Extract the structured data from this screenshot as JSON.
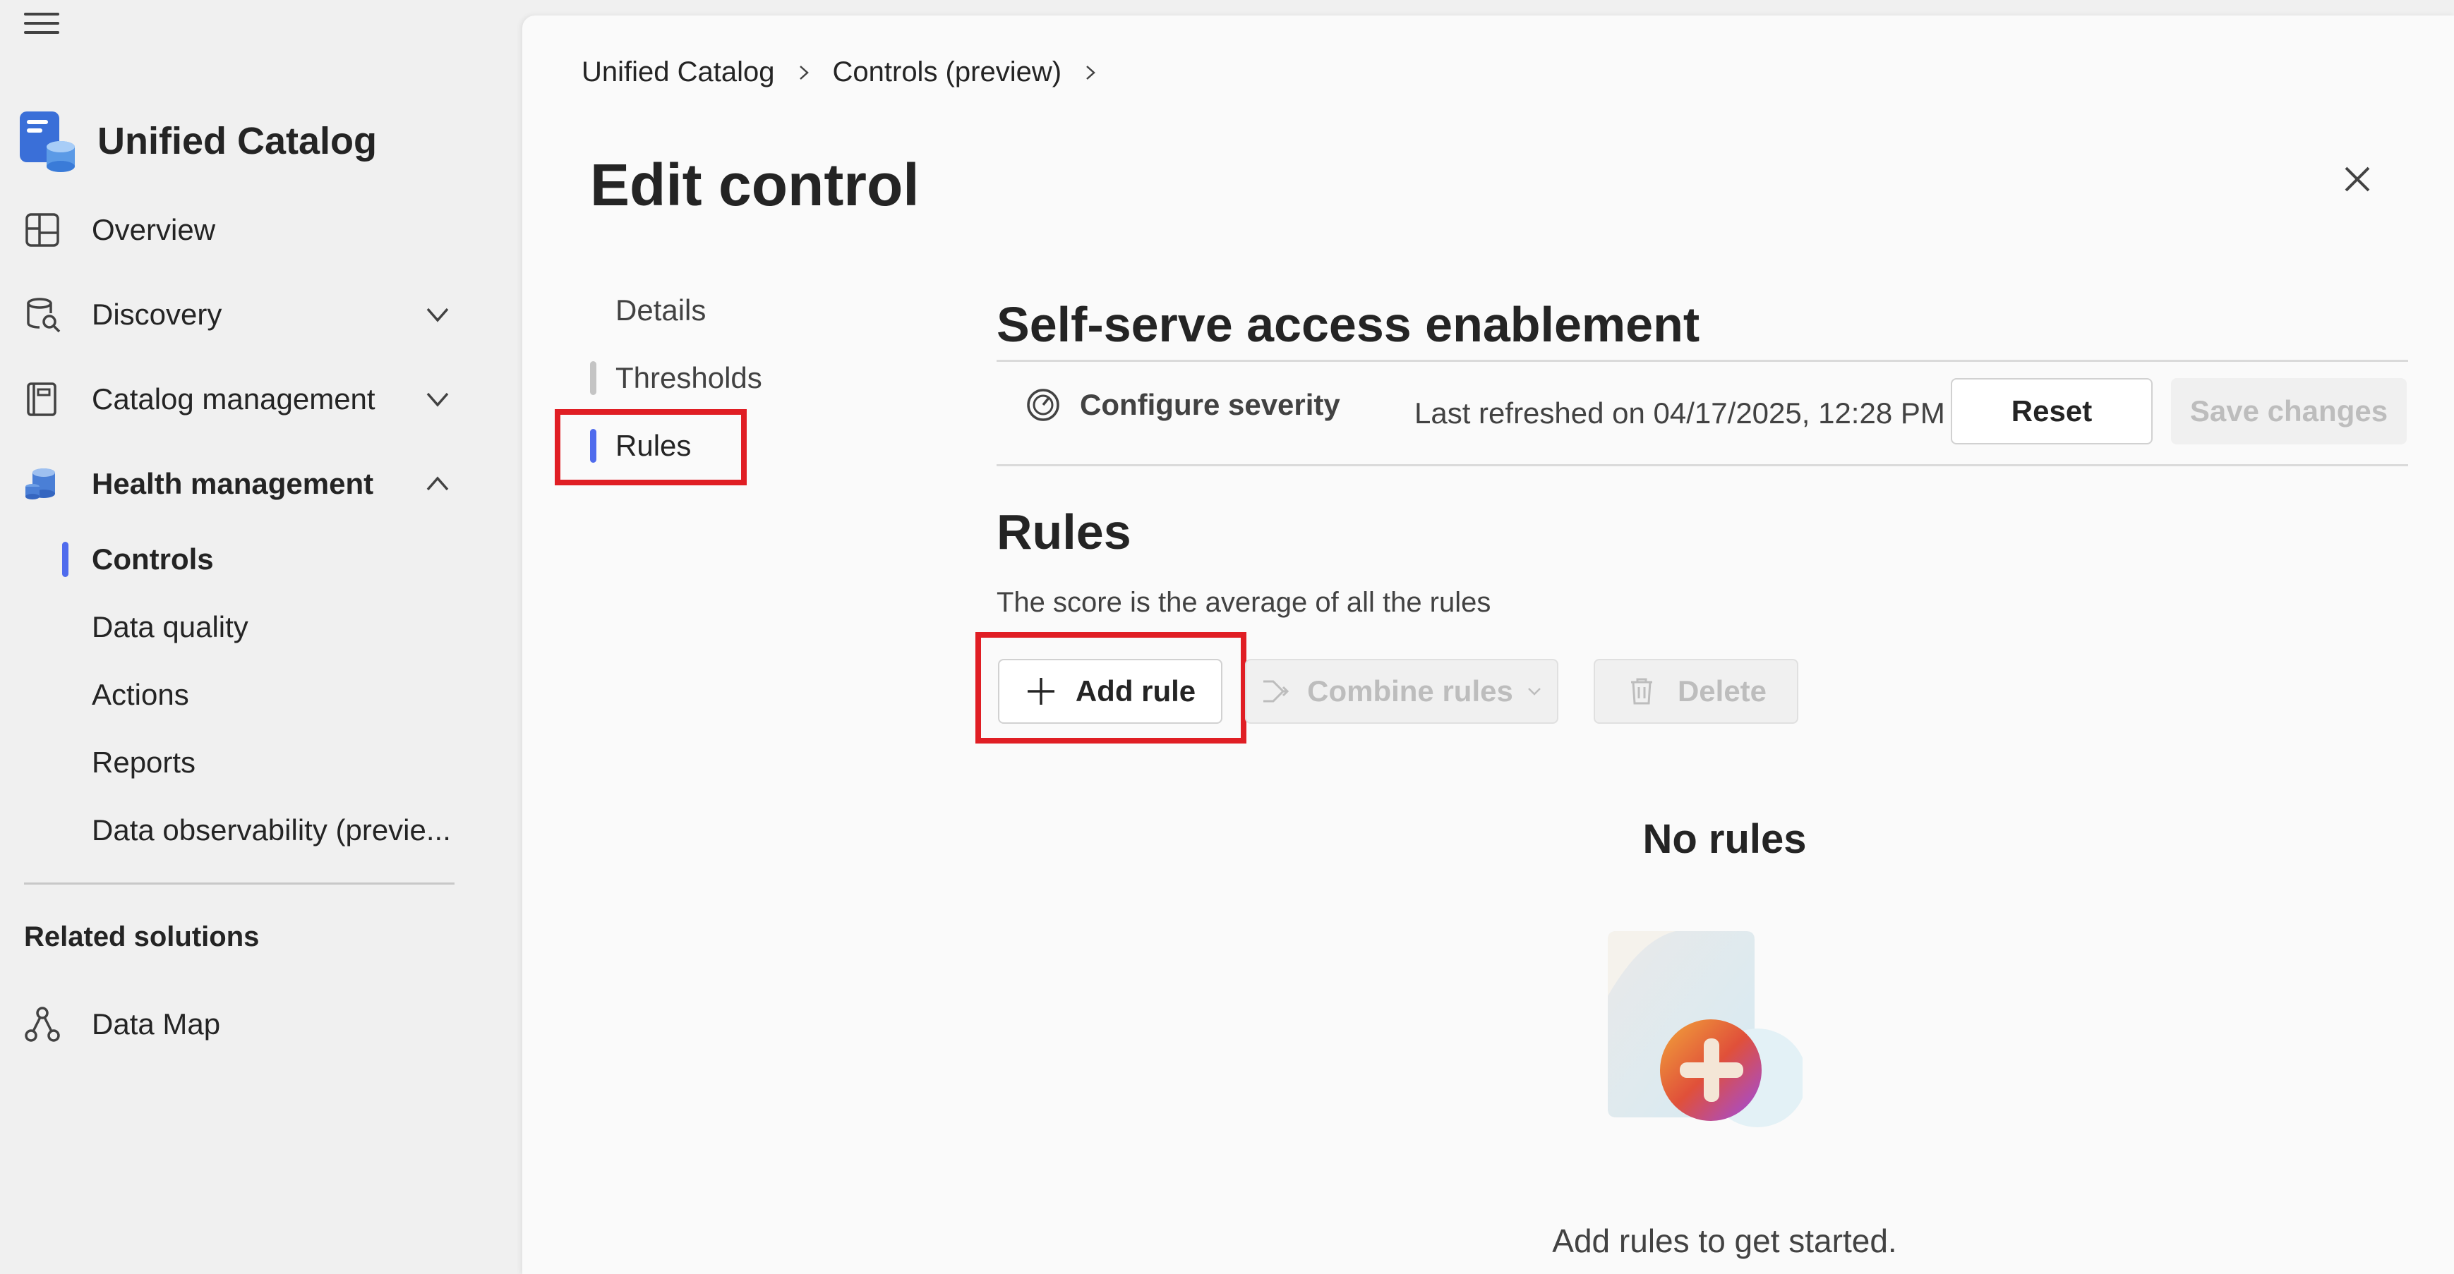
{
  "sidebar": {
    "app_title": "Unified Catalog",
    "items": [
      {
        "label": "Overview",
        "icon": "overview-grid-icon"
      },
      {
        "label": "Discovery",
        "icon": "discovery-database-search-icon",
        "expanded": false
      },
      {
        "label": "Catalog management",
        "icon": "catalog-book-icon",
        "expanded": false
      },
      {
        "label": "Health management",
        "icon": "health-database-icon",
        "expanded": true
      }
    ],
    "health_subitems": [
      {
        "label": "Controls",
        "selected": true
      },
      {
        "label": "Data quality"
      },
      {
        "label": "Actions"
      },
      {
        "label": "Reports"
      },
      {
        "label": "Data observability (previe..."
      }
    ],
    "related_label": "Related solutions",
    "related_items": [
      {
        "label": "Data Map",
        "icon": "data-map-nodes-icon"
      }
    ]
  },
  "breadcrumb": [
    "Unified Catalog",
    "Controls (preview)"
  ],
  "page": {
    "title": "Edit control"
  },
  "tabs": [
    {
      "label": "Details"
    },
    {
      "label": "Thresholds"
    },
    {
      "label": "Rules",
      "active": true
    }
  ],
  "control": {
    "name": "Self-serve access enablement",
    "configure_severity_label": "Configure severity",
    "last_refreshed": "Last refreshed on 04/17/2025, 12:28 PM",
    "reset_label": "Reset",
    "save_label": "Save changes"
  },
  "rules": {
    "title": "Rules",
    "description": "The score is the average of all the rules",
    "add_label": "Add rule",
    "combine_label": "Combine rules",
    "delete_label": "Delete",
    "empty_title": "No rules",
    "empty_hint": "Add rules to get started."
  },
  "colors": {
    "accent": "#4f6bed",
    "highlight": "#e01e24"
  }
}
